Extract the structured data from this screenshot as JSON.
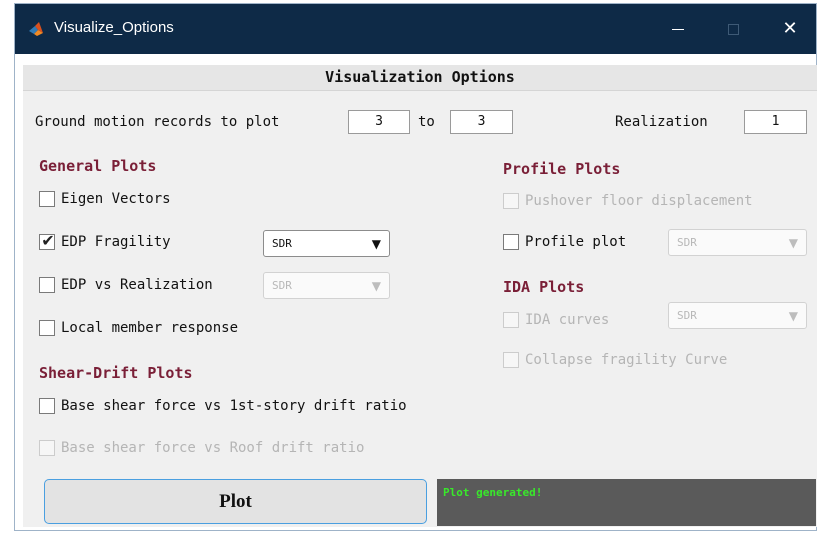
{
  "window": {
    "title": "Visualize_Options",
    "close_glyph": "✕"
  },
  "header": {
    "title": "Visualization Options"
  },
  "records": {
    "label": "Ground motion records to plot",
    "from": "3",
    "to_label": "to",
    "to": "3"
  },
  "realization": {
    "label": "Realization",
    "value": "1"
  },
  "general": {
    "title": "General Plots",
    "eigen": {
      "label": "Eigen Vectors",
      "checked": false
    },
    "edp_fragility": {
      "label": "EDP Fragility",
      "checked": true,
      "check_glyph": "✔",
      "dropdown": "SDR"
    },
    "edp_realization": {
      "label": "EDP vs Realization",
      "checked": false,
      "dropdown": "SDR"
    },
    "local_member": {
      "label": "Local member response",
      "checked": false
    }
  },
  "shear_drift": {
    "title": "Shear-Drift Plots",
    "first_story": {
      "label": "Base shear force vs 1st-story drift ratio",
      "checked": false
    },
    "roof": {
      "label": "Base shear force vs Roof drift ratio",
      "checked": false,
      "disabled": true
    }
  },
  "profile": {
    "title": "Profile Plots",
    "pushover": {
      "label": "Pushover floor displacement",
      "disabled": true
    },
    "profile_plot": {
      "label": "Profile plot",
      "checked": false,
      "dropdown": "SDR"
    }
  },
  "ida": {
    "title": "IDA Plots",
    "curves": {
      "label": "IDA curves",
      "disabled": true,
      "dropdown": "SDR"
    },
    "collapse": {
      "label": "Collapse fragility Curve",
      "disabled": true
    }
  },
  "plot_button": {
    "label": "Plot"
  },
  "status": {
    "text": "Plot generated!",
    "color": "#39e82b"
  },
  "dropdown_arrow": "▼",
  "colors": {
    "titlebar": "#0e2a47",
    "section": "#7a1f37",
    "status_bg": "#5a5a5a"
  },
  "icons": {
    "app": "matlab-icon",
    "minimize": "minimize-icon",
    "maximize": "maximize-icon",
    "close": "close-icon"
  }
}
